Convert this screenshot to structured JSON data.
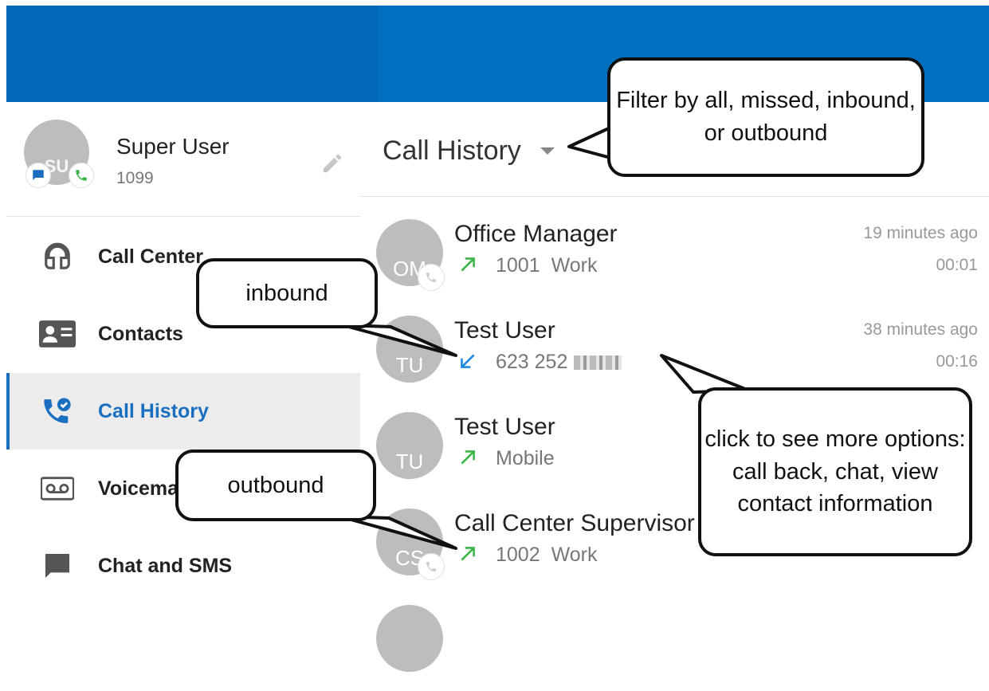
{
  "profile": {
    "name": "Super User",
    "extension": "1099",
    "initials": "SU"
  },
  "nav": {
    "items": [
      {
        "label": "Call Center",
        "icon": "headset-icon"
      },
      {
        "label": "Contacts",
        "icon": "contact-card-icon"
      },
      {
        "label": "Call History",
        "icon": "call-history-icon",
        "active": true
      },
      {
        "label": "Voicemail",
        "icon": "voicemail-icon"
      },
      {
        "label": "Chat and SMS",
        "icon": "chat-icon"
      }
    ]
  },
  "main": {
    "filter_title": "Call History",
    "calls": [
      {
        "initials": "OM",
        "name": "Office Manager",
        "direction": "outbound",
        "number": "1001",
        "type": "Work",
        "time": "19 minutes ago",
        "duration": "00:01"
      },
      {
        "initials": "TU",
        "name": "Test User",
        "direction": "inbound",
        "number": "623 252",
        "type": "",
        "time": "38 minutes ago",
        "duration": "00:16"
      },
      {
        "initials": "TU",
        "name": "Test User",
        "direction": "outbound",
        "number": "",
        "type": "Mobile",
        "time": "",
        "duration": ""
      },
      {
        "initials": "CS",
        "name": "Call Center Supervisor",
        "direction": "outbound",
        "number": "1002",
        "type": "Work",
        "time": "",
        "duration": ""
      }
    ]
  },
  "callouts": {
    "filter": "Filter by all, missed, inbound, or outbound",
    "inbound": "inbound",
    "outbound": "outbound",
    "more": "click to see more options: call back, chat, view contact information"
  },
  "colors": {
    "header_blue": "#0170c1",
    "accent_blue": "#1a6fc0",
    "outbound_green": "#3bb54a",
    "inbound_blue": "#1e88e5"
  }
}
